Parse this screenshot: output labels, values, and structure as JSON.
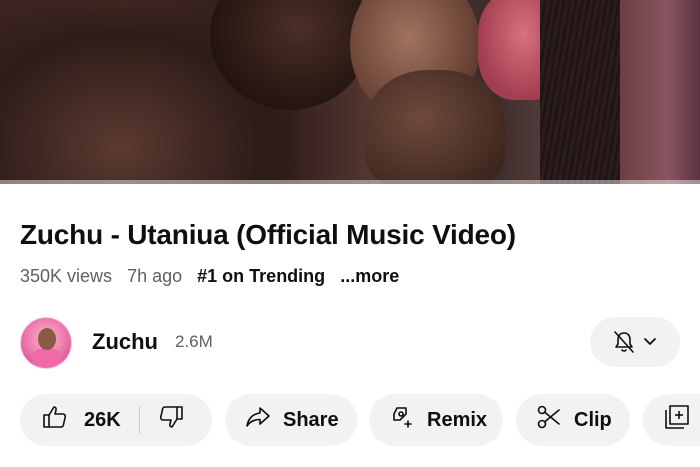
{
  "video": {
    "title": "Zuchu - Utaniua (Official Music Video)",
    "views": "350K views",
    "age": "7h ago",
    "trending": "#1 on Trending",
    "more": "...more"
  },
  "channel": {
    "name": "Zuchu",
    "subscribers": "2.6M",
    "notify_icon": "bell-off-icon"
  },
  "actions": {
    "like_count": "26K",
    "share_label": "Share",
    "remix_label": "Remix",
    "clip_label": "Clip"
  },
  "icons": {
    "like": "thumbs-up-icon",
    "dislike": "thumbs-down-icon",
    "share": "share-arrow-icon",
    "remix": "remix-icon",
    "clip": "scissors-icon",
    "save": "save-playlist-icon"
  },
  "colors": {
    "text": "#0f0f0f",
    "muted": "#606060",
    "pill": "#f2f2f2"
  }
}
